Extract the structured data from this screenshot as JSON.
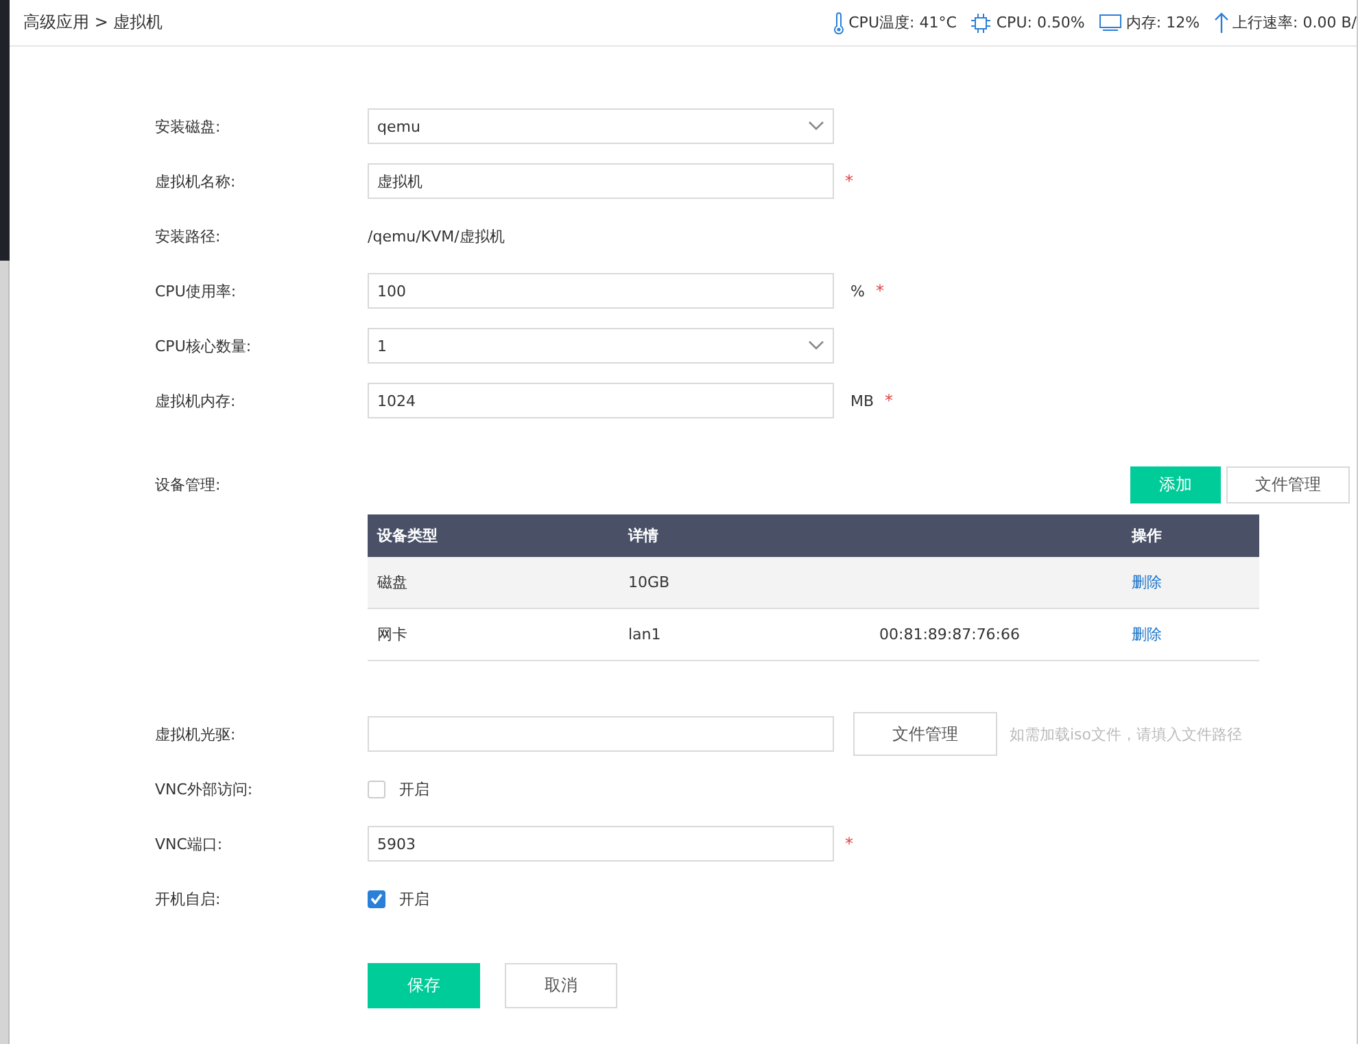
{
  "breadcrumb": "高级应用 > 虚拟机",
  "status": [
    {
      "kind": "thermometer",
      "text": "CPU温度: 41°C"
    },
    {
      "kind": "chip",
      "text": "CPU: 0.50%"
    },
    {
      "kind": "monitor",
      "text": "内存: 12%"
    },
    {
      "kind": "upload",
      "text": "上行速率: 0.00 B/"
    }
  ],
  "fields": [
    {
      "kind": "select",
      "label": "安装磁盘:",
      "value": "qemu"
    },
    {
      "kind": "input",
      "label": "虚拟机名称:",
      "value": "虚拟机",
      "required_mark": "*"
    },
    {
      "kind": "text",
      "label": "安装路径:",
      "value": "/qemu/KVM/虚拟机"
    },
    {
      "kind": "input",
      "label": "CPU使用率:",
      "value": "100",
      "unit": "%",
      "required_mark": "*"
    },
    {
      "kind": "select",
      "label": "CPU核心数量:",
      "value": "1"
    },
    {
      "kind": "input",
      "label": "虚拟机内存:",
      "value": "1024",
      "unit": "MB",
      "required_mark": "*"
    }
  ],
  "devices": {
    "label": "设备管理:",
    "add_button": "添加",
    "file_button": "文件管理",
    "columns": [
      "设备类型",
      "详情",
      "",
      "操作"
    ],
    "rows": [
      {
        "cells": [
          "磁盘",
          "10GB",
          ""
        ],
        "action": "删除"
      },
      {
        "cells": [
          "网卡",
          "lan1",
          "00:81:89:87:76:66"
        ],
        "action": "删除"
      }
    ]
  },
  "cdrom": {
    "label": "虚拟机光驱:",
    "button": "文件管理",
    "hint": "如需加载iso文件，请填入文件路径"
  },
  "vnc_access": {
    "label": "VNC外部访问:",
    "option": "开启",
    "checked": false
  },
  "vnc_port": {
    "label": "VNC端口:",
    "value": "5903",
    "required_mark": "*"
  },
  "autostart": {
    "label": "开机自启:",
    "option": "开启",
    "checked": true
  },
  "buttons": {
    "save": "保存",
    "cancel": "取消"
  }
}
